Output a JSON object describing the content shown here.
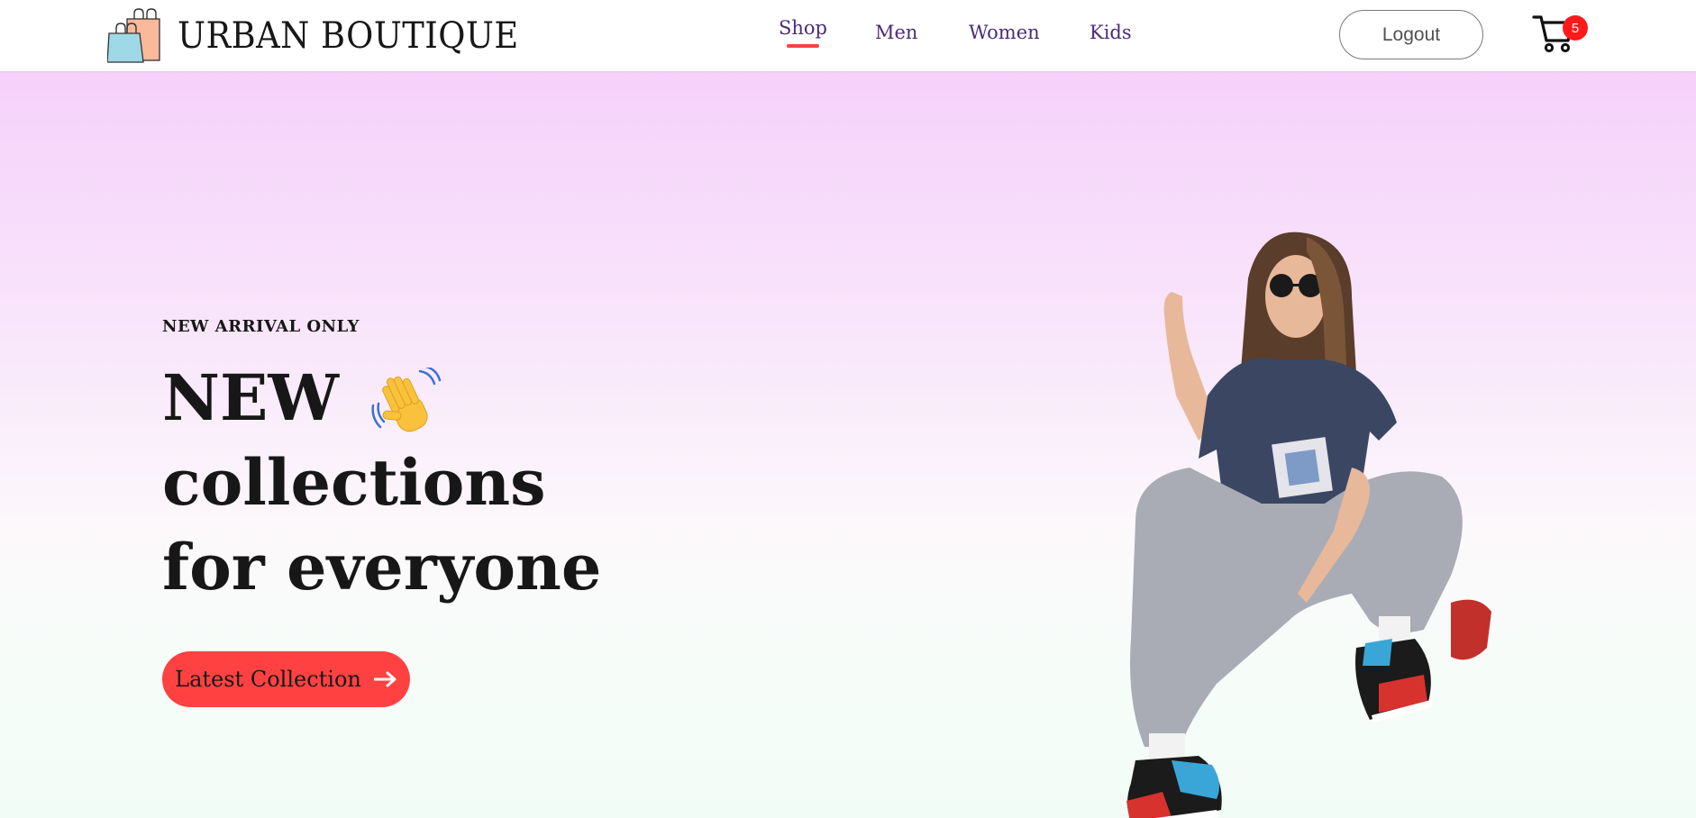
{
  "brand": {
    "name": "URBAN BOUTIQUE",
    "logo_icon": "shopping-bags-icon"
  },
  "nav": {
    "items": [
      {
        "label": "Shop",
        "active": true
      },
      {
        "label": "Men",
        "active": false
      },
      {
        "label": "Women",
        "active": false
      },
      {
        "label": "Kids",
        "active": false
      }
    ],
    "active_color": "#ff4141",
    "link_color": "#4a2c7a"
  },
  "header_actions": {
    "logout_label": "Logout",
    "cart_icon": "cart-icon",
    "cart_count": "5"
  },
  "hero": {
    "eyebrow": "NEW ARRIVAL ONLY",
    "headline_line1": "NEW",
    "headline_emoji": "waving-hand-icon",
    "headline_line2": "collections",
    "headline_line3": "for everyone",
    "cta_label": "Latest Collection",
    "cta_icon": "arrow-right-icon",
    "cta_color": "#ff4141",
    "hero_image": "model-photo"
  }
}
